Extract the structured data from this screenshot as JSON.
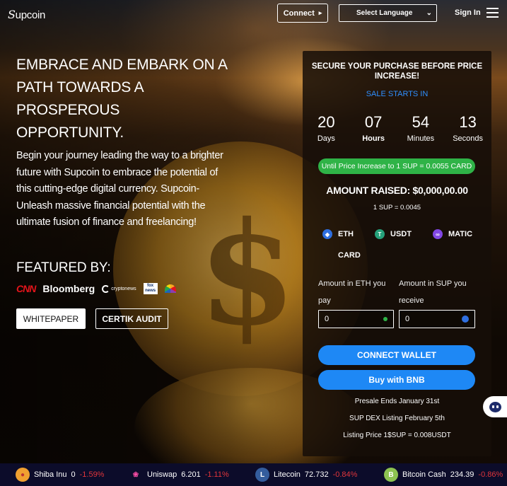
{
  "header": {
    "logo": "upcoin",
    "connect_label": "Connect",
    "language_select": "Select Language",
    "signin_label": "Sign In"
  },
  "hero": {
    "title": "EMBRACE AND EMBARK ON A PATH TOWARDS A PROSPEROUS OPPORTUNITY.",
    "description": "Begin your journey leading the way to a brighter future with Supcoin to embrace the potential of this cutting-edge digital currency. Supcoin- Unleash massive financial potential with the ultimate fusion of finance and freelancing!",
    "featured_label": "FEATURED BY:",
    "featured_logos": [
      "CNN",
      "Bloomberg",
      "cryptonews",
      "fox news",
      "NBC"
    ],
    "whitepaper_label": "WHITEPAPER",
    "certik_label": "CERTIK AUDIT"
  },
  "presale": {
    "heading": "SECURE YOUR PURCHASE BEFORE PRICE INCREASE!",
    "sale_starts": "SALE STARTS IN",
    "countdown": [
      {
        "value": "20",
        "label": "Days"
      },
      {
        "value": "07",
        "label": "Hours"
      },
      {
        "value": "54",
        "label": "Minutes"
      },
      {
        "value": "13",
        "label": "Seconds"
      }
    ],
    "price_increase": "Until Price Increase to 1 SUP = 0.0055 CARD",
    "amount_raised": "AMOUNT RAISED: $0,000,00.00",
    "rate": "1 SUP = 0.0045",
    "payment_options": [
      "ETH",
      "USDT",
      "MATIC",
      "CARD"
    ],
    "pay_label": "Amount in ETH you pay",
    "receive_label": "Amount in SUP you receive",
    "pay_value": "0",
    "receive_value": "0",
    "connect_wallet": "CONNECT WALLET",
    "buy_bnb": "Buy with BNB",
    "presale_ends": "Presale Ends January 31st",
    "dex_listing": "SUP DEX Listing February 5th",
    "listing_price": "Listing Price 1$SUP = 0.008USDT"
  },
  "ticker": [
    {
      "name": "Shiba Inu",
      "price": "0",
      "change": "-1.59%"
    },
    {
      "name": "Uniswap",
      "price": "6.201",
      "change": "-1.11%"
    },
    {
      "name": "Litecoin",
      "price": "72.732",
      "change": "-0.84%"
    },
    {
      "name": "Bitcoin Cash",
      "price": "234.39",
      "change": "-0.86%"
    }
  ],
  "colors": {
    "accent_blue": "#1e88f5",
    "sale_blue": "#2f8fff",
    "pill_green": "#2fb347",
    "negative_red": "#e0353b"
  }
}
